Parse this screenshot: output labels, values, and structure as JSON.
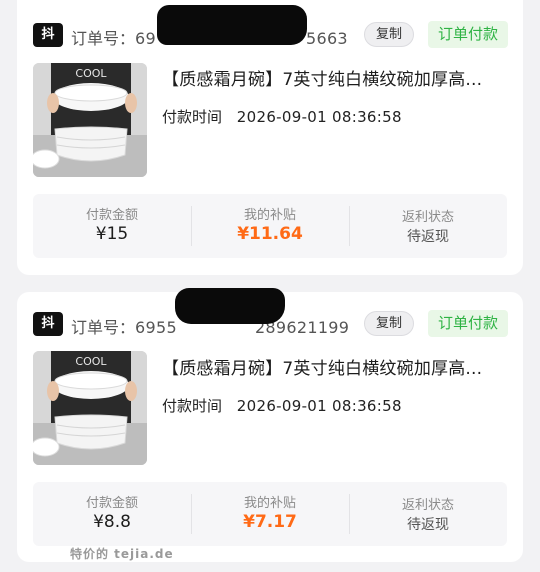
{
  "orders": [
    {
      "platform_badge": "抖",
      "order_label": "订单号：",
      "order_number_visible": "69",
      "order_number_tail": "5663",
      "copy_label": "复制",
      "status": "订单付款",
      "title": "【质感霜月碗】7英寸纯白横纹碗加厚高...",
      "pay_label": "付款时间",
      "pay_time": "2026-09-01 08:36:58",
      "stats": [
        {
          "label": "付款金额",
          "value": "¥15"
        },
        {
          "label": "我的补贴",
          "value": "¥11.64"
        },
        {
          "label": "返利状态",
          "value": "待返现"
        }
      ],
      "thumb_text": "COOL"
    },
    {
      "platform_badge": "抖",
      "order_label": "订单号：",
      "order_number_visible": "6955",
      "order_number_tail": "289621199",
      "copy_label": "复制",
      "status": "订单付款",
      "title": "【质感霜月碗】7英寸纯白横纹碗加厚高...",
      "pay_label": "付款时间",
      "pay_time": "2026-09-01 08:36:58",
      "stats": [
        {
          "label": "付款金额",
          "value": "¥8.8"
        },
        {
          "label": "我的补贴",
          "value": "¥7.17"
        },
        {
          "label": "返利状态",
          "value": "待返现"
        }
      ],
      "thumb_text": "COOL"
    }
  ],
  "watermark": "特价的 tejia.de",
  "colors": {
    "status_green": "#2fb344",
    "subsidy_orange": "#ff6a16"
  }
}
